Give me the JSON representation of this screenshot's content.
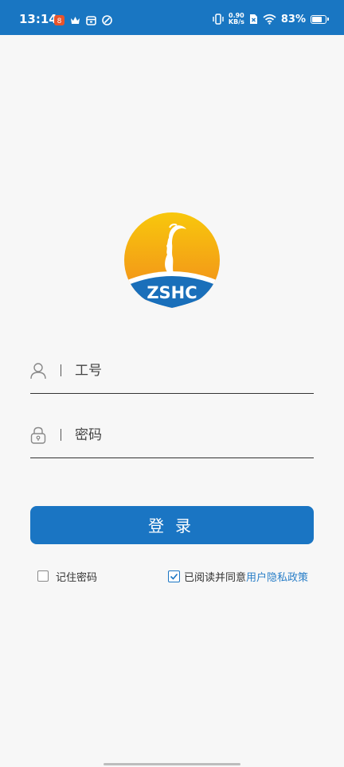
{
  "status_bar": {
    "time": "13:14",
    "net_speed_value": "0.90",
    "net_speed_unit": "KB/s",
    "battery_percent": "83%",
    "battery_level": 0.83,
    "left_icons": [
      "notification-app-icon",
      "crown-icon",
      "calendar-icon",
      "leaf-icon"
    ],
    "right_icons": [
      "vibrate-icon",
      "sim-icon",
      "wifi-icon",
      "battery-icon"
    ]
  },
  "logo": {
    "text": "ZSHC",
    "colors": {
      "sun_top": "#f7c20a",
      "sun_bottom": "#f08a1a",
      "banner": "#1a6fba"
    }
  },
  "form": {
    "username": {
      "placeholder": "工号",
      "value": "",
      "icon": "user-icon"
    },
    "password": {
      "placeholder": "密码",
      "value": "",
      "icon": "lock-icon"
    },
    "login_label": "登录",
    "remember": {
      "label": "记住密码",
      "checked": false
    },
    "agreement": {
      "label": "已阅读并同意",
      "link": "用户隐私政策",
      "checked": true
    }
  },
  "colors": {
    "primary": "#1a75c3",
    "status_bar": "#1976c2",
    "link": "#2a7fc8",
    "background": "#f7f7f7"
  }
}
